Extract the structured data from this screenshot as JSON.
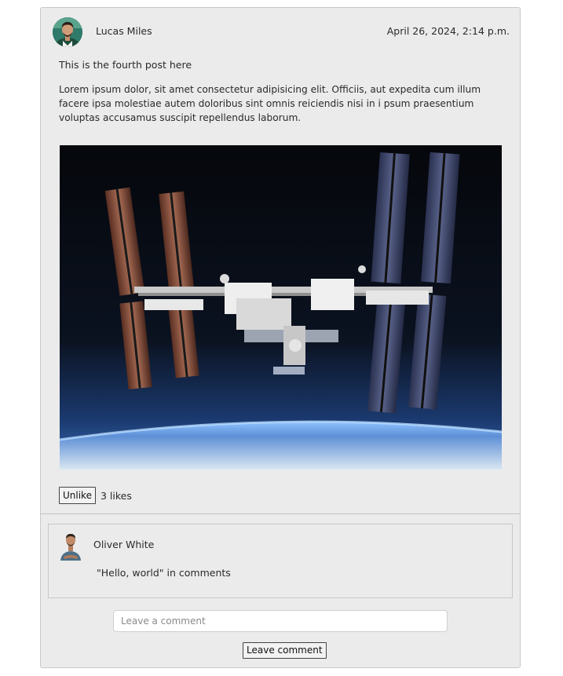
{
  "post": {
    "author_name": "Lucas Miles",
    "date": "April 26, 2024, 2:14 p.m.",
    "title": "This is the fourth post here",
    "body": "Lorem ipsum dolor, sit amet consectetur adipisicing elit. Officiis, aut expedita cum illum facere ipsa molestiae autem doloribus sint omnis reiciendis nisi in i psum praesentium voluptas accusamus suscipit repellendus laborum.",
    "image_subject": "space-station-photo"
  },
  "likes": {
    "unlike_label": "Unlike",
    "count_text": "3 likes"
  },
  "comments": [
    {
      "author_name": "Oliver White",
      "text": "\"Hello, world\" in comments"
    }
  ],
  "comment_form": {
    "placeholder": "Leave a comment",
    "value": "",
    "submit_label": "Leave comment"
  },
  "colors": {
    "card_background": "#ebebeb",
    "border": "#c8c8c8",
    "text": "#2a2a2a"
  }
}
